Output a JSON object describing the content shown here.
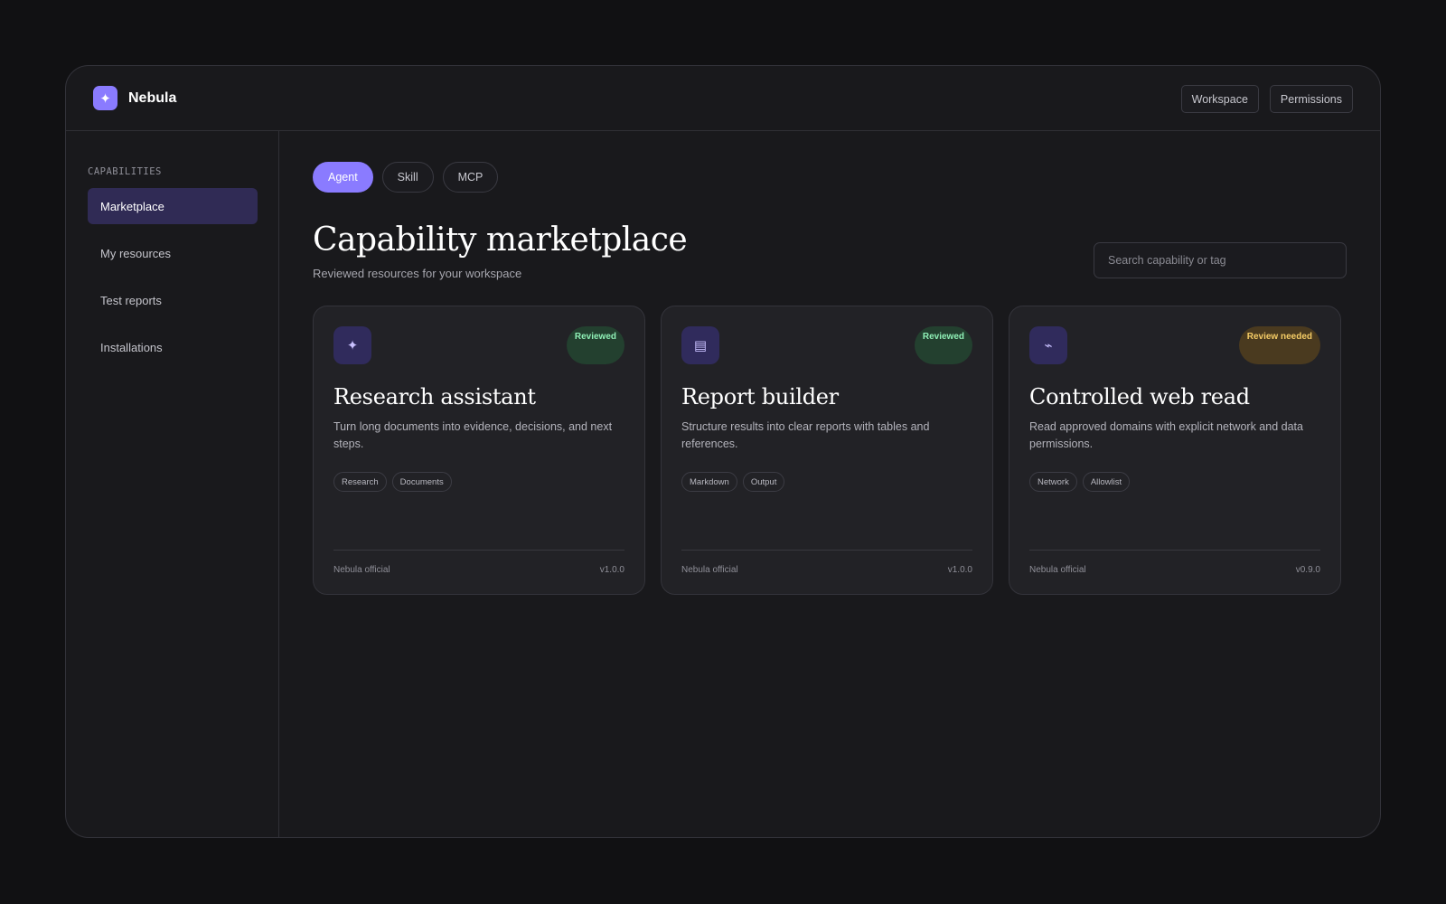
{
  "app": {
    "name": "Nebula",
    "logo_glyph": "✦"
  },
  "header": {
    "actions": [
      {
        "label": "Workspace"
      },
      {
        "label": "Permissions"
      }
    ]
  },
  "sidebar": {
    "heading": "CAPABILITIES",
    "items": [
      {
        "label": "Marketplace",
        "active": true
      },
      {
        "label": "My resources",
        "active": false
      },
      {
        "label": "Test reports",
        "active": false
      },
      {
        "label": "Installations",
        "active": false
      }
    ]
  },
  "main": {
    "tabs": [
      {
        "label": "Agent",
        "active": true
      },
      {
        "label": "Skill",
        "active": false
      },
      {
        "label": "MCP",
        "active": false
      }
    ],
    "title": "Capability marketplace",
    "subtitle": "Reviewed resources for your workspace",
    "search": {
      "placeholder": "Search capability or tag",
      "value": ""
    },
    "cards": [
      {
        "icon": "sparkle-icon",
        "icon_glyph": "✦",
        "badge": "Reviewed",
        "badge_status": "ok",
        "title": "Research assistant",
        "description": "Turn long documents into evidence, decisions, and next steps.",
        "tags": [
          "Research",
          "Documents"
        ],
        "publisher": "Nebula official",
        "version": "v1.0.0"
      },
      {
        "icon": "document-icon",
        "icon_glyph": "▤",
        "badge": "Reviewed",
        "badge_status": "ok",
        "title": "Report builder",
        "description": "Structure results into clear reports with tables and references.",
        "tags": [
          "Markdown",
          "Output"
        ],
        "publisher": "Nebula official",
        "version": "v1.0.0"
      },
      {
        "icon": "plug-icon",
        "icon_glyph": "⌁",
        "badge": "Review needed",
        "badge_status": "warn",
        "title": "Controlled web read",
        "description": "Read approved domains with explicit network and data permissions.",
        "tags": [
          "Network",
          "Allowlist"
        ],
        "publisher": "Nebula official",
        "version": "v0.9.0"
      }
    ]
  },
  "colors": {
    "accent": "#8a7bff",
    "active_nav": "#302b55",
    "reviewed_badge": "#8ff0b6",
    "review_needed_badge": "#f5cc66"
  }
}
